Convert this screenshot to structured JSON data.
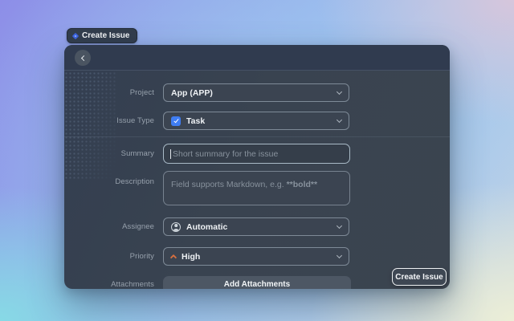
{
  "tab": {
    "label": "Create Issue"
  },
  "dialog": {
    "fields": {
      "project": {
        "label": "Project",
        "value": "App (APP)"
      },
      "issue_type": {
        "label": "Issue Type",
        "value": "Task"
      },
      "summary": {
        "label": "Summary",
        "placeholder": "Short summary for the issue"
      },
      "description": {
        "label": "Description",
        "placeholder_prefix": "Field supports Markdown, e.g. ",
        "placeholder_bold": "**bold**"
      },
      "assignee": {
        "label": "Assignee",
        "value": "Automatic"
      },
      "priority": {
        "label": "Priority",
        "value": "High"
      },
      "attachments": {
        "label": "Attachments",
        "button_label": "Add Attachments"
      }
    },
    "submit_label": "Create Issue"
  },
  "colors": {
    "accent_blue": "#3f7df2",
    "priority_high_orange": "#d9703f",
    "tab_diamond_blue": "#3c63e0"
  }
}
